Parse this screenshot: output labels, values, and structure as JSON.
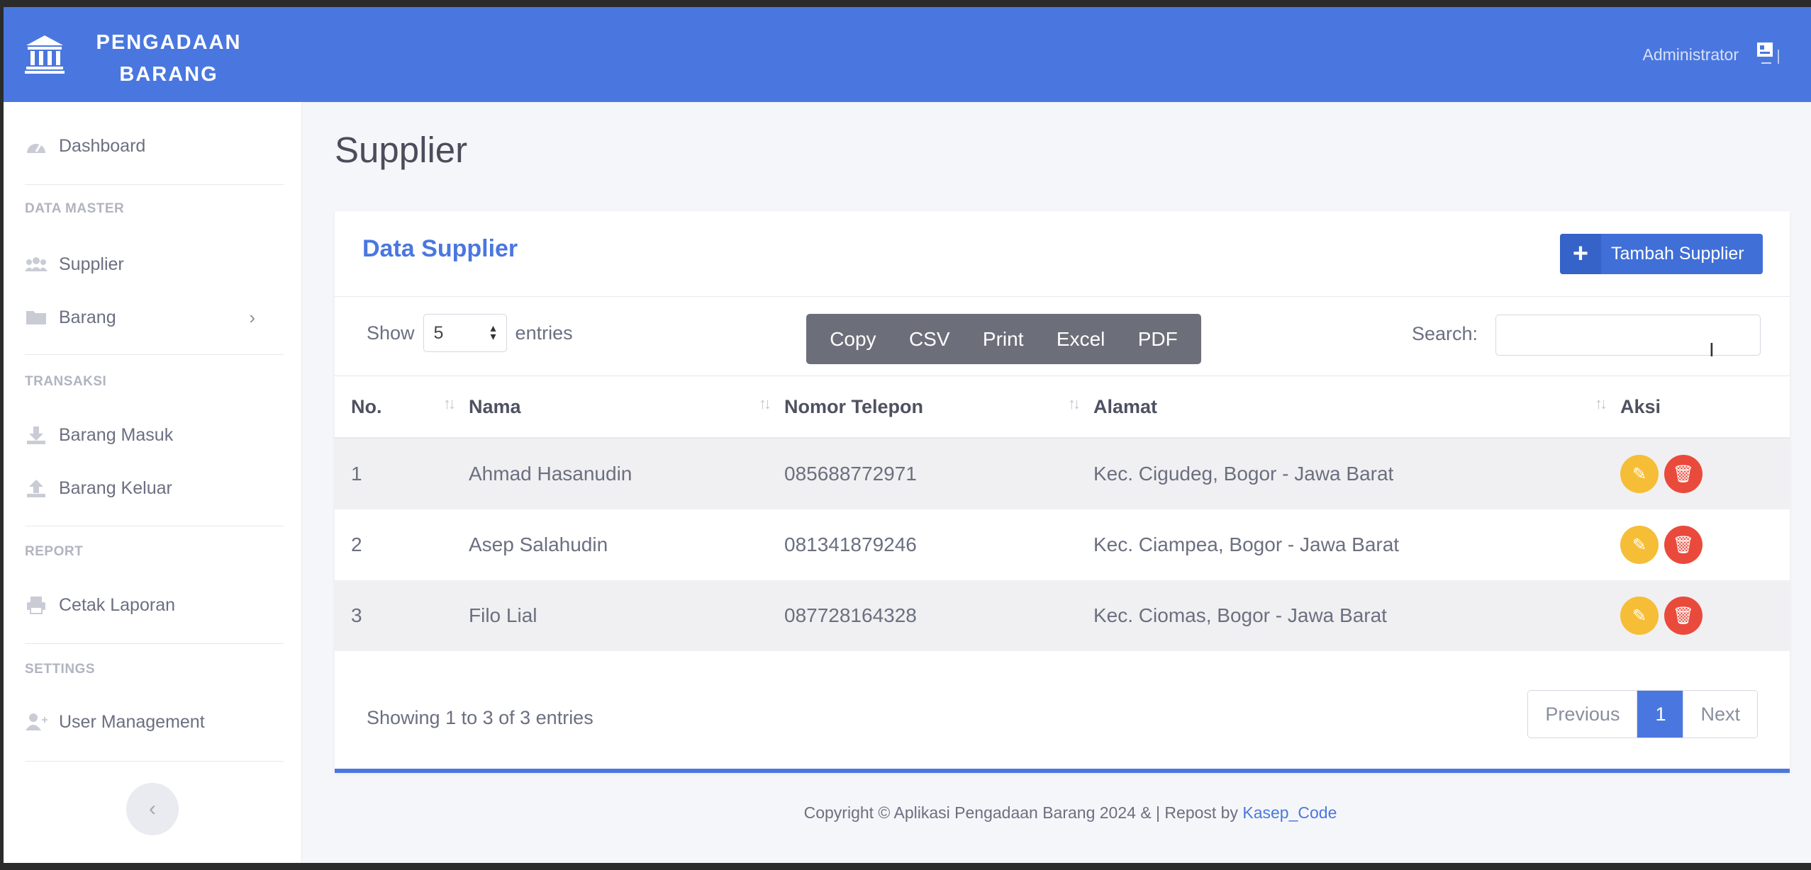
{
  "brand": {
    "line1": "PENGADAAN",
    "line2": "BARANG",
    "icon": "university-icon"
  },
  "topbar": {
    "user_name": "Administrator"
  },
  "sidebar": {
    "dashboard": "Dashboard",
    "heading_master": "DATA MASTER",
    "supplier": "Supplier",
    "barang": "Barang",
    "heading_transaksi": "TRANSAKSI",
    "barang_masuk": "Barang Masuk",
    "barang_keluar": "Barang Keluar",
    "heading_report": "REPORT",
    "cetak_laporan": "Cetak Laporan",
    "heading_settings": "SETTINGS",
    "user_management": "User Management"
  },
  "page": {
    "title": "Supplier"
  },
  "card": {
    "title": "Data Supplier",
    "add_button": "Tambah Supplier",
    "show_label": "Show",
    "entries_label": "entries",
    "page_size": "5",
    "export_buttons": [
      "Copy",
      "CSV",
      "Print",
      "Excel",
      "PDF"
    ],
    "search_label": "Search:",
    "search_value": ""
  },
  "table": {
    "headers": [
      "No.",
      "Nama",
      "Nomor Telepon",
      "Alamat",
      "Aksi"
    ],
    "rows": [
      {
        "no": "1",
        "nama": "Ahmad Hasanudin",
        "telepon": "085688772971",
        "alamat": "Kec. Cigudeg, Bogor - Jawa Barat"
      },
      {
        "no": "2",
        "nama": "Asep Salahudin",
        "telepon": "081341879246",
        "alamat": "Kec. Ciampea, Bogor - Jawa Barat"
      },
      {
        "no": "3",
        "nama": "Filo Lial",
        "telepon": "087728164328",
        "alamat": "Kec. Ciomas, Bogor - Jawa Barat"
      }
    ]
  },
  "pagination": {
    "info": "Showing 1 to 3 of 3 entries",
    "previous": "Previous",
    "current": "1",
    "next": "Next"
  },
  "footer": {
    "text": "Copyright © Aplikasi Pengadaan Barang 2024 & | Repost by ",
    "link": "Kasep_Code"
  },
  "colors": {
    "primary": "#4a77df",
    "edit": "#f6be36",
    "delete": "#ea4a3b"
  }
}
